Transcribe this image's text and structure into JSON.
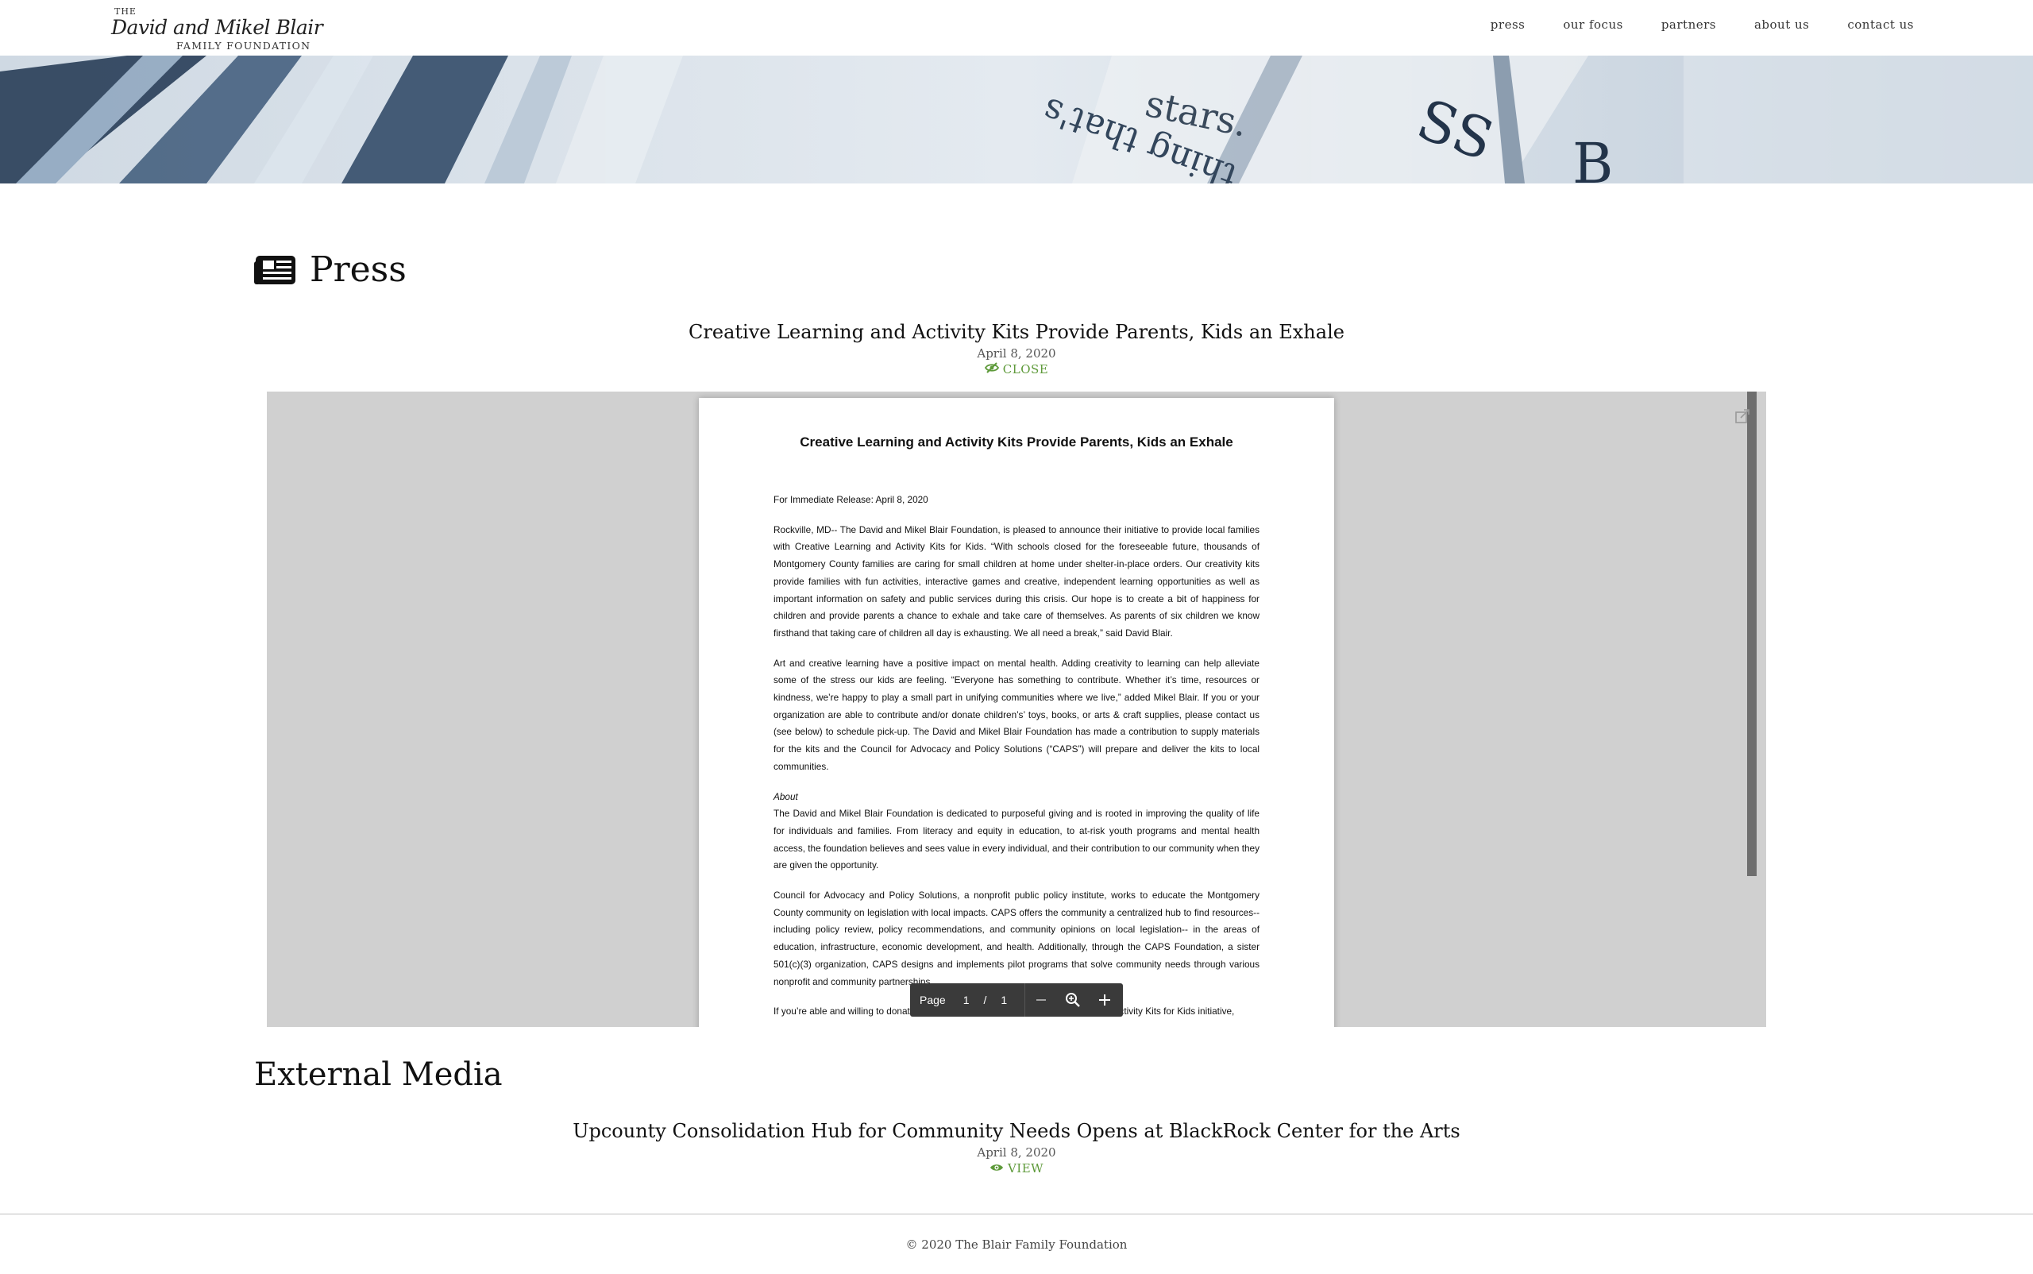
{
  "logo": {
    "the": "THE",
    "script": "David and Mikel Blair",
    "sub": "FAMILY FOUNDATION"
  },
  "nav": {
    "items": [
      "press",
      "our focus",
      "partners",
      "about us",
      "contact us"
    ]
  },
  "press_section": {
    "title": "Press",
    "article": {
      "title": "Creative Learning and Activity Kits Provide Parents, Kids an Exhale",
      "date": "April 8, 2020",
      "action": "CLOSE"
    }
  },
  "pdf": {
    "title": "Creative Learning and Activity Kits Provide Parents, Kids an Exhale",
    "release": "For Immediate Release: April 8, 2020",
    "para1": "Rockville, MD-- The David and Mikel Blair Foundation, is pleased to announce their initiative to provide local families with Creative Learning and Activity Kits for Kids.  “With schools closed for the foreseeable future, thousands of Montgomery County families are caring for small children at home under shelter-in-place orders. Our creativity kits provide families with fun activities, interactive games and creative, independent learning opportunities as well as important information on safety and public services during this crisis.  Our hope is to create a bit of happiness for children and provide parents a chance to exhale and take care of themselves.  As parents of six children we know firsthand that taking care of children all day is exhausting.  We all need a break,” said David Blair.",
    "para2": "Art and creative learning have a positive impact on mental health. Adding creativity to learning can help alleviate some of the stress our kids are feeling.   “Everyone has something to contribute. Whether it’s time, resources or kindness, we’re happy to play a small part in unifying communities where we live,” added Mikel Blair.  If you or your organization are able to contribute and/or donate children’s’ toys, books, or arts & craft supplies, please contact us (see below) to schedule pick-up. The David and Mikel Blair Foundation has made a contribution to supply materials for the kits and the Council for Advocacy and Policy Solutions (“CAPS”) will prepare and deliver the kits to local communities.",
    "about_label": "About",
    "para3": "The David and Mikel Blair Foundation is dedicated to purposeful giving and is rooted in improving the quality of life for individuals and families. From literacy and equity in education, to at-risk youth programs and mental health access, the foundation believes and sees value in every individual, and their contribution to our community when they are given the opportunity.",
    "para4": "Council for Advocacy and Policy Solutions, a nonprofit public policy institute, works to educate the Montgomery County community on legislation with local impacts. CAPS offers the community a centralized hub to find resources-- including policy review, policy recommendations, and community opinions on local legislation-- in the areas of education, infrastructure, economic development, and health. Additionally, through the CAPS Foundation, a sister 501(c)(3) organization, CAPS designs and implements pilot programs that solve community needs through various nonprofit and community partnerships.",
    "para5": "If you’re able and willing to donate time or resources to the Creative Learning and Activity Kits for Kids initiative,",
    "toolbar": {
      "page_label": "Page",
      "current_page": "1",
      "separator": "/",
      "total_pages": "1"
    }
  },
  "external_section": {
    "title": "External Media",
    "article": {
      "title": "Upcounty Consolidation Hub for Community Needs Opens at BlackRock Center for the Arts",
      "date": "April 8, 2020",
      "action": "VIEW"
    }
  },
  "footer": {
    "copyright": "© 2020 The Blair Family Foundation"
  },
  "colors": {
    "accent_green": "#5e9a3a",
    "viewer_bg": "#d0d0d0",
    "toolbar_bg": "#3a3a3a"
  },
  "icons": {
    "press": "newspaper-icon",
    "close": "eye-slash-icon",
    "view": "eye-icon",
    "popout": "external-link-icon",
    "zoom_out": "minus-icon",
    "zoom": "magnifier-icon",
    "zoom_in": "plus-icon"
  }
}
